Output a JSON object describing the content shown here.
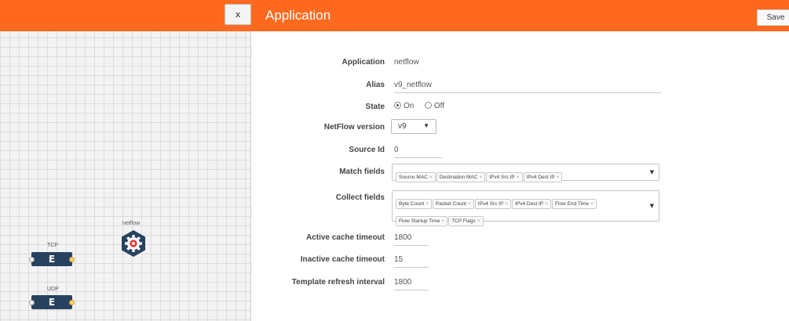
{
  "canvas": {
    "close_label": "x",
    "nodes": {
      "tcp_label": "TCP",
      "tcp_glyph": "E",
      "udp_label": "UDP",
      "udp_glyph": "E",
      "netflow_label": "netflow"
    }
  },
  "panel": {
    "title": "Application",
    "save_label": "Save",
    "fields": {
      "application": {
        "label": "Application",
        "value": "netflow"
      },
      "alias": {
        "label": "Alias",
        "value": "v9_netflow"
      },
      "state": {
        "label": "State",
        "on_label": "On",
        "off_label": "Off",
        "selected": "On"
      },
      "netflow_version": {
        "label": "NetFlow version",
        "value": "v9",
        "caret": "▼"
      },
      "source_id": {
        "label": "Source Id",
        "value": "0"
      },
      "match_fields": {
        "label": "Match fields",
        "chips": [
          "Source MAC",
          "Destination MAC",
          "IPv4 Src IP",
          "IPv4 Dest IP"
        ]
      },
      "collect_fields": {
        "label": "Collect fields",
        "chips": [
          "Byte Count",
          "Packet Count",
          "IPv4 Src IP",
          "IPv4 Dest IP",
          "Flow End Time",
          "Flow Startup Time",
          "TCP Flags"
        ]
      },
      "active_cache_timeout": {
        "label": "Active cache timeout",
        "value": "1800"
      },
      "inactive_cache_timeout": {
        "label": "Inactive cache timeout",
        "value": "15"
      },
      "template_refresh_interval": {
        "label": "Template refresh interval",
        "value": "1800"
      }
    },
    "chip_remove_glyph": "×",
    "dropdown_arrow": "▼"
  },
  "colors": {
    "header_orange": "#ff6a1f",
    "node_navy": "#27425f"
  }
}
